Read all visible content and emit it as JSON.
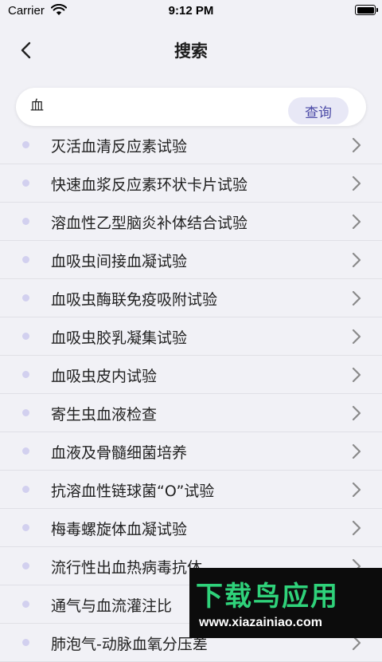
{
  "status_bar": {
    "carrier": "Carrier",
    "time": "9:12 PM"
  },
  "nav": {
    "title": "搜索",
    "back_icon": "chevron-left-icon"
  },
  "search": {
    "value": "血",
    "placeholder": "",
    "query_label": "查询"
  },
  "results": [
    "灭活血清反应素试验",
    "快速血浆反应素环状卡片试验",
    "溶血性乙型脑炎补体结合试验",
    "血吸虫间接血凝试验",
    "血吸虫酶联免疫吸附试验",
    "血吸虫胶乳凝集试验",
    "血吸虫皮内试验",
    "寄生虫血液检查",
    "血液及骨髓细菌培养",
    "抗溶血性链球菌“O”试验",
    "梅毒螺旋体血凝试验",
    "流行性出血热病毒抗体",
    "通气与血流灌注比",
    "肺泡气-动脉血氧分压差"
  ],
  "watermark": {
    "title": "下载鸟应用",
    "url": "www.xiazainiao.com"
  },
  "colors": {
    "background": "#f1f1f6",
    "accent": "#4b4aa6",
    "query_button_bg": "#e8e8f6",
    "bullet": "#d2d0ef",
    "watermark_green": "#2fd27a"
  }
}
